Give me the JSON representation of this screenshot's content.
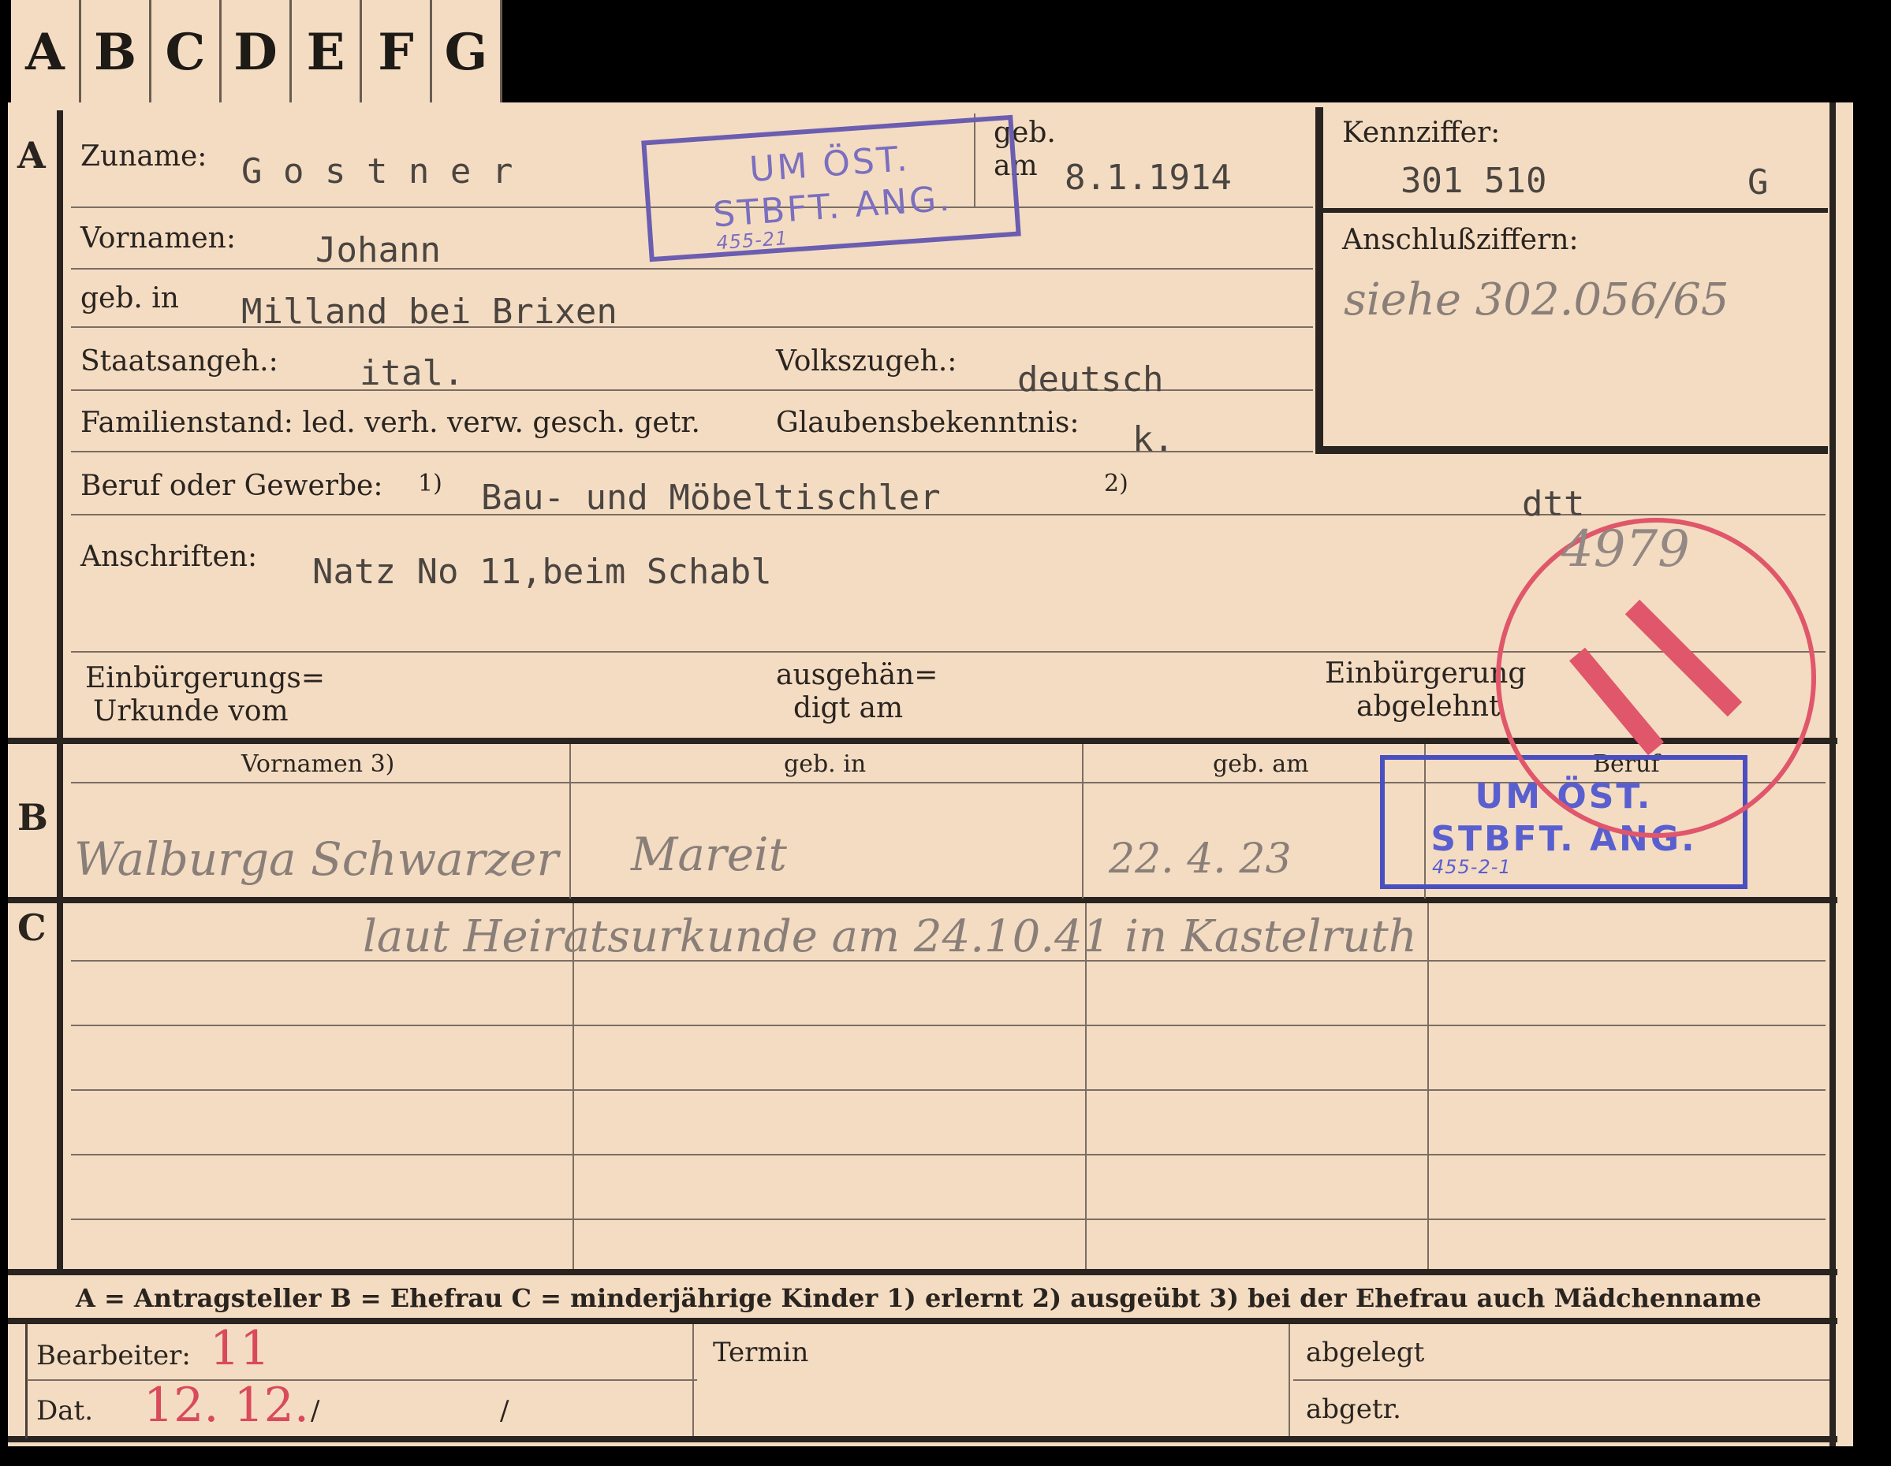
{
  "tabs": [
    "A",
    "B",
    "C",
    "D",
    "E",
    "F",
    "G"
  ],
  "sections": {
    "a": "A",
    "b": "B",
    "c": "C"
  },
  "header": {
    "zuname_label": "Zuname:",
    "zuname_value": "G o s t n e r",
    "geb_label": "geb.",
    "am_label": "am",
    "geb_am_value": "8.1.1914",
    "vornamen_label": "Vornamen:",
    "vornamen_value": "Johann",
    "geb_in_label": "geb. in",
    "geb_in_value": "Milland bei Brixen",
    "staatsangeh_label": "Staatsangeh.:",
    "staatsangeh_value": "ital.",
    "volkszugeh_label": "Volkszugeh.:",
    "volkszugeh_value": "deutsch",
    "familienstand_label": "Familienstand: led. verh. verw. gesch. getr.",
    "glaubens_label": "Glaubensbekenntnis:",
    "glaubens_value": "k.",
    "beruf_label": "Beruf oder Gewerbe:",
    "beruf_mark1": "1)",
    "beruf_value": "Bau- und Möbeltischler",
    "beruf_mark2": "2)",
    "beruf_value2": "dtt",
    "anschriften_label": "Anschriften:",
    "anschriften_value": "Natz No 11,beim Schabl",
    "einb_urkunde_label1": "Einbürgerungs=",
    "einb_urkunde_label2": "Urkunde vom",
    "ausgehaen_label1": "ausgehän=",
    "ausgehaen_label2": "digt am",
    "einb_abgelehnt_label1": "Einbürgerung",
    "einb_abgelehnt_label2": "abgelehnt"
  },
  "kennziffer": {
    "label": "Kennziffer:",
    "value": "301 510",
    "suffix": "G",
    "anschluss_label": "Anschlußziffern:",
    "anschluss_value": "siehe 302.056/65"
  },
  "stamp_top": {
    "line1": "UM ÖST.",
    "line2": "STBFT. ANG.",
    "note": "455-21"
  },
  "stamp_b": {
    "line1": "UM ÖST.",
    "line2": "STBFT. ANG.",
    "note": "455-2-1"
  },
  "red_stamp": {
    "number": "4979",
    "big": "11"
  },
  "section_b": {
    "col_vornamen": "Vornamen",
    "col_vornamen_mark": "3)",
    "col_geb_in": "geb. in",
    "col_geb_am": "geb. am",
    "col_beruf": "Beruf",
    "row_vornamen": "Walburga Schwarzer",
    "row_geb_in": "Mareit",
    "row_geb_am": "22. 4. 23"
  },
  "section_c": {
    "note": "laut Heiratsurkunde am 24.10.41 in Kastelruth"
  },
  "legend": "A = Antragsteller   B = Ehefrau   C = minderjährige Kinder   1) erlernt   2) ausgeübt   3) bei der Ehefrau auch Mädchenname",
  "footer": {
    "bearbeiter_label": "Bearbeiter:",
    "bearbeiter_value": "11",
    "dat_label": "Dat.",
    "dat_value": "12. 12.",
    "slash1": "/",
    "slash2": "/",
    "termin_label": "Termin",
    "abgelegt_label": "abgelegt",
    "abgetr_label": "abgetr."
  },
  "colors": {
    "card": "#f4dcc3",
    "ink": "#2a241f",
    "stamp_violet": "#6b5db0",
    "stamp_red": "#e0566a",
    "pencil_red": "#d94a5a"
  }
}
